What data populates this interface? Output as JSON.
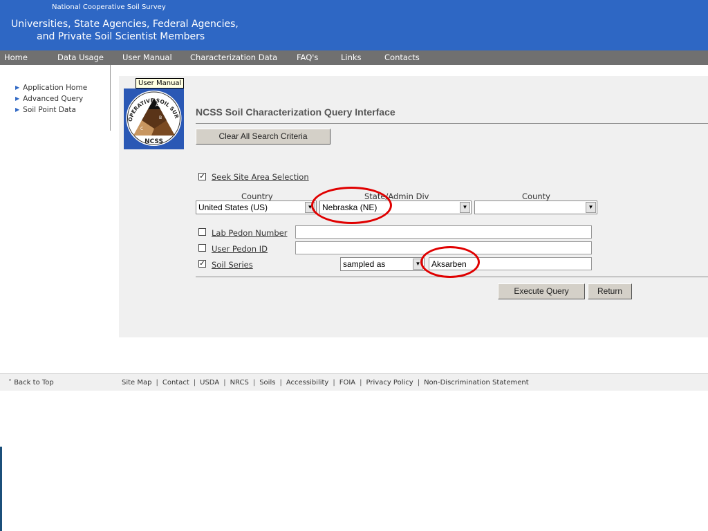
{
  "header": {
    "org_name": "National Cooperative Soil Survey",
    "tagline_line1": "Universities, State Agencies, Federal Agencies,",
    "tagline_line2": "and Private Soil Scientist Members",
    "bg_color": "#2e67c4"
  },
  "nav": {
    "items": [
      "Home",
      "Data Usage",
      "User Manual",
      "Characterization Data",
      "FAQ's",
      "Links",
      "Contacts"
    ]
  },
  "sidebar": {
    "items": [
      "Application Home",
      "Advanced Query",
      "Soil Point Data"
    ]
  },
  "tooltip": {
    "text": "User Manual"
  },
  "logo": {
    "top_text": "COOPERATIVE SOIL SURVEY",
    "bottom_text": "NCSS",
    "horizons": [
      "A",
      "B",
      "C"
    ]
  },
  "page": {
    "title": "NCSS Soil Characterization Query Interface",
    "clear_button": "Clear All Search Criteria"
  },
  "form": {
    "site_area": {
      "label": "Seek Site Area Selection",
      "checked": true
    },
    "columns": {
      "country": "Country",
      "state": "State/Admin Div",
      "county": "County"
    },
    "country_value": "United States (US)",
    "state_value": "Nebraska (NE)",
    "county_value": "",
    "lab_pedon": {
      "label": "Lab Pedon Number",
      "checked": false,
      "value": ""
    },
    "user_pedon": {
      "label": "User Pedon ID",
      "checked": false,
      "value": ""
    },
    "soil_series": {
      "label": "Soil Series",
      "checked": true,
      "mode": "sampled as",
      "value": "Aksarben"
    }
  },
  "buttons": {
    "execute": "Execute Query",
    "return": "Return"
  },
  "footer": {
    "back_to_top": "Back to Top",
    "links": [
      "Site Map",
      "Contact",
      "USDA",
      "NRCS",
      "Soils",
      "Accessibility",
      "FOIA",
      "Privacy Policy",
      "Non-Discrimination Statement"
    ]
  },
  "highlight_color": "#e00000"
}
